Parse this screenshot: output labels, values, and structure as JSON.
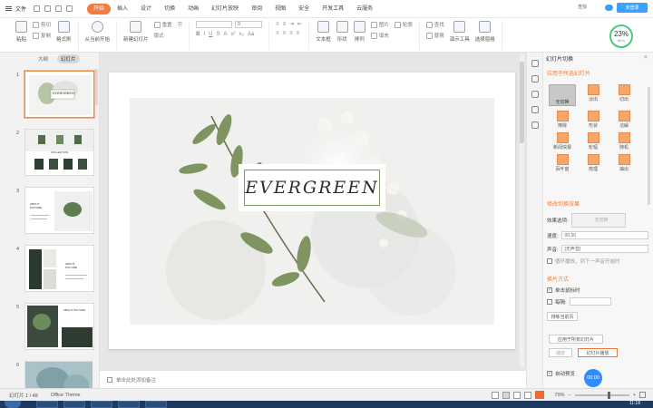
{
  "menubar": {
    "file_label": "文件",
    "tabs": [
      {
        "label": "开始",
        "active": true
      },
      {
        "label": "插入"
      },
      {
        "label": "设计"
      },
      {
        "label": "切换"
      },
      {
        "label": "动画"
      },
      {
        "label": "幻灯片放映"
      },
      {
        "label": "审阅"
      },
      {
        "label": "视图"
      },
      {
        "label": "安全"
      },
      {
        "label": "开发工具"
      },
      {
        "label": "云服务"
      }
    ],
    "search_label": "查找",
    "cloud_button": "未登录"
  },
  "ribbon": {
    "paste": "粘贴",
    "cut": "剪切",
    "copy": "复制",
    "format_painter": "格式刷",
    "start_show": "从当前开始",
    "new_slide": "新建幻灯片",
    "layout": "版式",
    "section": "节",
    "reset": "重置",
    "font_value": "",
    "size_value": "0",
    "textbox": "文本框",
    "shape": "形状",
    "arrange": "排列",
    "picture": "图片",
    "fill": "填充",
    "outline": "轮廓",
    "find": "查找",
    "replace": "替换",
    "presenter_tools": "演示工具",
    "select_pane": "选择窗格"
  },
  "gauge": {
    "percent": "23%",
    "unit": "8K/s"
  },
  "left_panel": {
    "tabs": [
      {
        "label": "大纲"
      },
      {
        "label": "幻灯片",
        "active": true
      }
    ],
    "slides": [
      {
        "num": "1",
        "caption": "EVERGREEN"
      },
      {
        "num": "2",
        "caption": "COLLECTION"
      },
      {
        "num": "3",
        "caption": "ABOUT PICTURE"
      },
      {
        "num": "4",
        "caption": "ABOUT PICTURE"
      },
      {
        "num": "5",
        "caption": "ABOUT PICTURE"
      },
      {
        "num": "6",
        "caption": ""
      }
    ]
  },
  "slide": {
    "title": "EVERGREEN"
  },
  "notes": {
    "placeholder": "单击此处添加备注"
  },
  "right_panel": {
    "header": "幻灯片切换",
    "apply_section": "应用于所选幻灯片",
    "transitions": [
      {
        "label": "无切换",
        "selected": true
      },
      {
        "label": "淡出"
      },
      {
        "label": "切出"
      },
      {
        "label": "擦除"
      },
      {
        "label": "形状"
      },
      {
        "label": "溶解"
      },
      {
        "label": "新闻快报"
      },
      {
        "label": "轮辐"
      },
      {
        "label": "随机"
      },
      {
        "label": "百叶窗"
      },
      {
        "label": "梳理"
      },
      {
        "label": "抽出"
      }
    ],
    "modify_section": "修改切换效果",
    "effect_option_label": "效果选项:",
    "effect_option_value": "无切换",
    "speed_label": "速度:",
    "speed_value": "00.50",
    "sound_label": "声音:",
    "sound_value": "[无声音]",
    "loop_label": "循环播放，到下一声音开始时",
    "advance_section": "换片方式",
    "on_click_label": "单击鼠标时",
    "interval_label": "每隔:",
    "interval_value": "",
    "rehearse_button": "排练当前页",
    "apply_all_button": "应用于所有幻灯片",
    "play_button": "播放",
    "slideshow_button": "幻灯片播放",
    "autopreview_label": "自动预览"
  },
  "timer": "00:00",
  "status": {
    "slide_info": "幻灯片 1 / 48",
    "theme": "Office Theme",
    "zoom": "79%"
  },
  "taskbar": {
    "clock": "11:18"
  }
}
